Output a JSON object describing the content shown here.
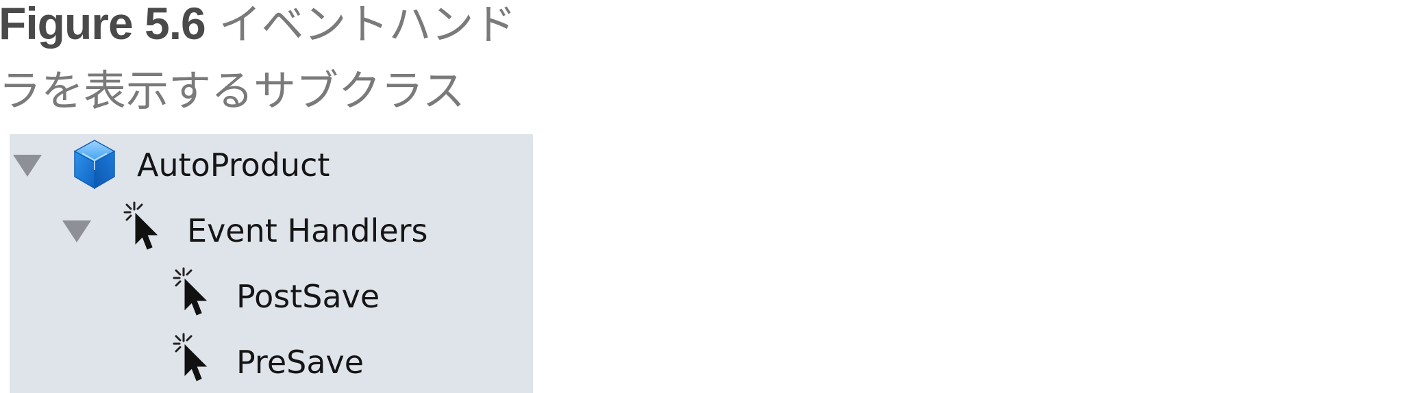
{
  "caption": {
    "figure_label": "Figure 5.6",
    "text": "イベントハンドラを表示するサブクラス"
  },
  "tree": {
    "items": [
      {
        "label": "AutoProduct",
        "icon": "cube-icon",
        "level": 0,
        "expanded": true
      },
      {
        "label": "Event Handlers",
        "icon": "cursor-click-icon",
        "level": 1,
        "expanded": true
      },
      {
        "label": "PostSave",
        "icon": "cursor-click-icon",
        "level": 2
      },
      {
        "label": "PreSave",
        "icon": "cursor-click-icon",
        "level": 2
      }
    ]
  },
  "colors": {
    "panel_background": "#dfe3ea",
    "cube": "#1f86e0",
    "disclosure_triangle": "#8d9197"
  }
}
